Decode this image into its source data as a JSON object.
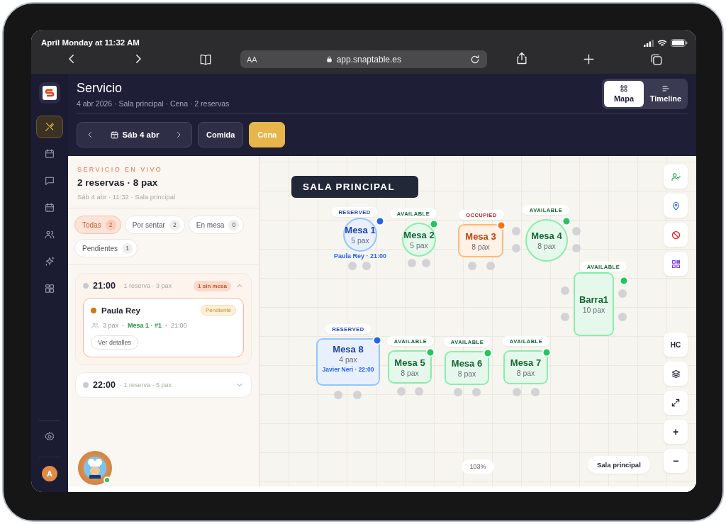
{
  "browser": {
    "status_time": "April Monday at 11:32 AM",
    "reader_label": "AA",
    "url": "app.snaptable.es"
  },
  "sidebar": {
    "items": [
      {
        "selected": true
      },
      {
        "selected": false
      },
      {
        "selected": false
      },
      {
        "selected": false
      },
      {
        "selected": false
      },
      {
        "selected": false
      },
      {
        "selected": false
      }
    ],
    "avatar_initial": "A"
  },
  "header": {
    "title": "Servicio",
    "subtitle": "4 abr 2026 · Sala principal · Cena · 2 reservas",
    "view_toggle": [
      {
        "label": "Mapa",
        "selected": true
      },
      {
        "label": "Timeline",
        "selected": false
      }
    ],
    "date": "Sáb 4 abr",
    "services": [
      {
        "label": "Comida",
        "selected": false
      },
      {
        "label": "Cena",
        "selected": true
      }
    ]
  },
  "live": {
    "eyebrow": "SERVICIO EN VIVO",
    "summary": "2 reservas · 8 pax",
    "meta": "Sáb 4 abr · 11:32 · Sala principal",
    "filters": [
      {
        "label": "Todas",
        "count": "2",
        "selected": true
      },
      {
        "label": "Por sentar",
        "count": "2",
        "selected": false
      },
      {
        "label": "En mesa",
        "count": "0",
        "selected": false
      },
      {
        "label": "Pendientes",
        "count": "1",
        "selected": false
      }
    ],
    "groups": [
      {
        "time": "21:00",
        "meta": "· 1 reserva · 3 pax",
        "badge": "1 sin mesa",
        "expanded": true,
        "reservations": [
          {
            "name": "Paula Rey",
            "color": "#d97706",
            "status": "Pendiente",
            "pax": "3 pax",
            "separator": "·",
            "table": "Mesa 1 · #1",
            "time": "21:00",
            "action": "Ver detalles"
          }
        ]
      },
      {
        "time": "22:00",
        "meta": "· 1 reserva · 5 pax",
        "expanded": false
      }
    ]
  },
  "map": {
    "room": "SALA PRINCIPAL",
    "tables": [
      {
        "name": "Mesa 1",
        "pax": "5 pax",
        "status": "RESERVED",
        "kind": "reserved",
        "color": "#2563eb",
        "guest": "Paula Rey · 21:00"
      },
      {
        "name": "Mesa 2",
        "pax": "5 pax",
        "status": "AVAILABLE",
        "kind": "available",
        "color": "#22c55e"
      },
      {
        "name": "Mesa 3",
        "pax": "8 pax",
        "status": "OCCUPIED",
        "kind": "occupied",
        "color": "#f97316"
      },
      {
        "name": "Mesa 4",
        "pax": "8 pax",
        "status": "AVAILABLE",
        "kind": "available",
        "color": "#22c55e"
      },
      {
        "name": "Barra1",
        "pax": "10 pax",
        "status": "AVAILABLE",
        "kind": "available",
        "color": "#22c55e"
      },
      {
        "name": "Mesa 8",
        "pax": "4 pax",
        "status": "RESERVED",
        "kind": "reserved",
        "color": "#2563eb",
        "guest": "Javier Neri · 22:00"
      },
      {
        "name": "Mesa 5",
        "pax": "8 pax",
        "status": "AVAILABLE",
        "kind": "available",
        "color": "#22c55e"
      },
      {
        "name": "Mesa 6",
        "pax": "8 pax",
        "status": "AVAILABLE",
        "kind": "available",
        "color": "#22c55e"
      },
      {
        "name": "Mesa 7",
        "pax": "8 pax",
        "status": "AVAILABLE",
        "kind": "available",
        "color": "#22c55e"
      }
    ],
    "tools": [
      {
        "kind": "guests"
      },
      {
        "kind": "locate"
      },
      {
        "kind": "block"
      },
      {
        "kind": "qr"
      },
      {
        "kind": "label",
        "label": "HC"
      },
      {
        "kind": "layers"
      },
      {
        "kind": "expand"
      },
      {
        "kind": "label",
        "label": "+"
      },
      {
        "kind": "label",
        "label": "−"
      }
    ],
    "zoom": "103%",
    "room_button": "Sala principal"
  }
}
